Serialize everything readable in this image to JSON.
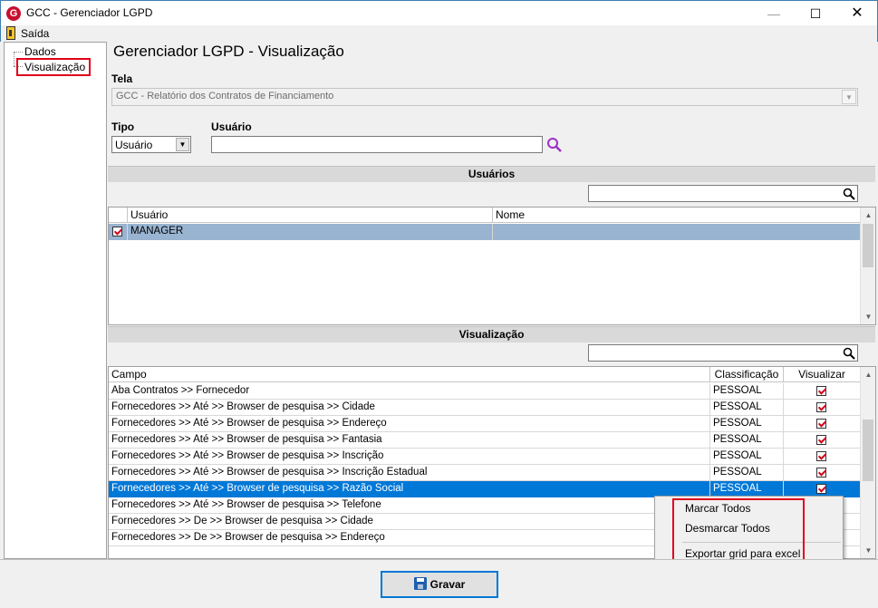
{
  "window": {
    "title": "GCC - Gerenciador LGPD"
  },
  "menu": {
    "exit_label": "Saída"
  },
  "tree": {
    "items": [
      "Dados",
      "Visualização"
    ]
  },
  "page": {
    "title": "Gerenciador LGPD - Visualização"
  },
  "form": {
    "tela_label": "Tela",
    "tela_value": "GCC - Relatório dos Contratos de Financiamento",
    "tipo_label": "Tipo",
    "tipo_value": "Usuário",
    "usuario_label": "Usuário",
    "usuario_value": ""
  },
  "users_section": {
    "title": "Usuários",
    "columns": [
      "Usuário",
      "Nome"
    ],
    "rows": [
      {
        "usuario": "MANAGER",
        "nome": "",
        "checked": true
      }
    ]
  },
  "vis_section": {
    "title": "Visualização",
    "columns": [
      "Campo",
      "Classificação",
      "Visualizar"
    ],
    "rows": [
      {
        "campo": "Aba Contratos >> Fornecedor",
        "classificacao": "PESSOAL",
        "visualizar": true
      },
      {
        "campo": "Fornecedores >> Até >> Browser de pesquisa >> Cidade",
        "classificacao": "PESSOAL",
        "visualizar": true
      },
      {
        "campo": "Fornecedores >> Até >> Browser de pesquisa >> Endereço",
        "classificacao": "PESSOAL",
        "visualizar": true
      },
      {
        "campo": "Fornecedores >> Até >> Browser de pesquisa >> Fantasia",
        "classificacao": "PESSOAL",
        "visualizar": true
      },
      {
        "campo": "Fornecedores >> Até >> Browser de pesquisa >> Inscrição",
        "classificacao": "PESSOAL",
        "visualizar": true
      },
      {
        "campo": "Fornecedores >> Até >> Browser de pesquisa >> Inscrição Estadual",
        "classificacao": "PESSOAL",
        "visualizar": true
      },
      {
        "campo": "Fornecedores >> Até >> Browser de pesquisa >> Razão Social",
        "classificacao": "PESSOAL",
        "visualizar": true
      },
      {
        "campo": "Fornecedores >> Até >> Browser de pesquisa >> Telefone",
        "classificacao": "",
        "visualizar": false
      },
      {
        "campo": "Fornecedores >> De >> Browser de pesquisa >> Cidade",
        "classificacao": "",
        "visualizar": false
      },
      {
        "campo": "Fornecedores >> De >> Browser de pesquisa >> Endereço",
        "classificacao": "",
        "visualizar": false
      }
    ]
  },
  "context_menu": {
    "items": [
      "Marcar Todos",
      "Desmarcar Todos",
      "Exportar grid para excel"
    ]
  },
  "footer": {
    "save_label": "Gravar"
  },
  "icons": {
    "app": "gcc-logo-icon",
    "exit": "exit-door-icon",
    "search_purple": "search-icon",
    "filter": "search-icon",
    "save": "floppy-disk-icon"
  },
  "colors": {
    "selection_blue": "#0078d7",
    "selection_light": "#99b4d1",
    "highlight_red": "#e0001a",
    "check_red": "#d0021b"
  }
}
